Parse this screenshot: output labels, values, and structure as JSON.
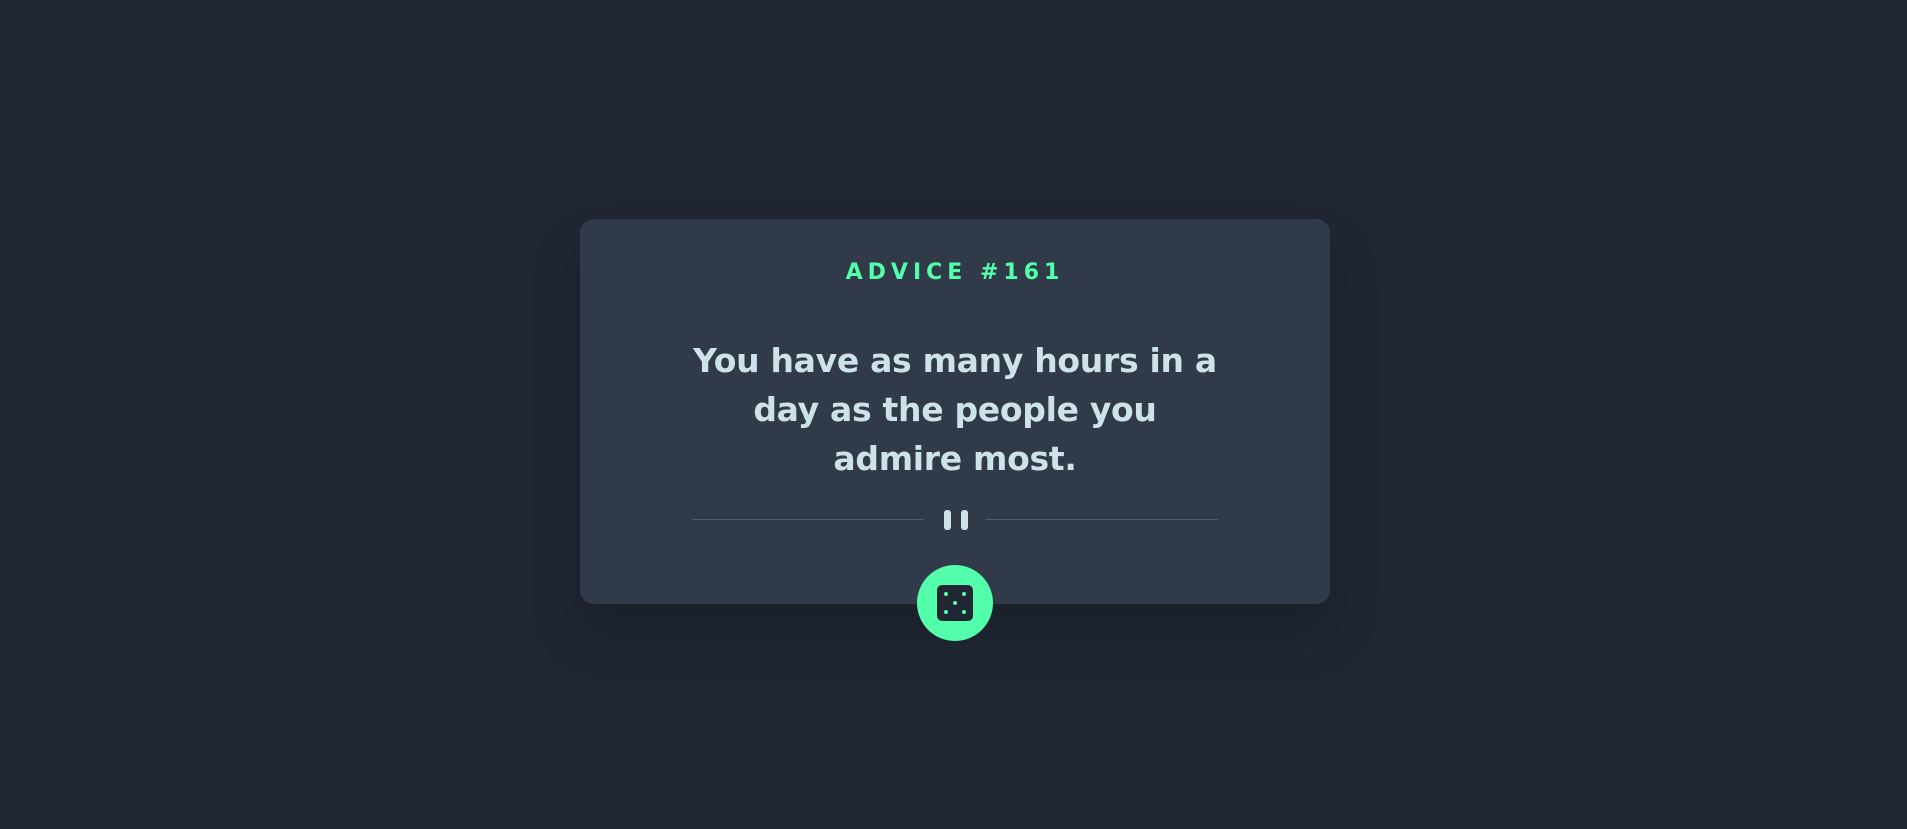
{
  "advice": {
    "id_label": "ADVICE #161",
    "text": "You have as many hours in a day as the people you admire most."
  },
  "divider": {
    "icon": "pause-icon"
  },
  "dice_button": {
    "icon": "dice-icon"
  },
  "colors": {
    "background": "#202733",
    "card": "#313a48",
    "accent": "#53ffaa",
    "text": "#cee3e9",
    "divider": "#4f5d74"
  }
}
